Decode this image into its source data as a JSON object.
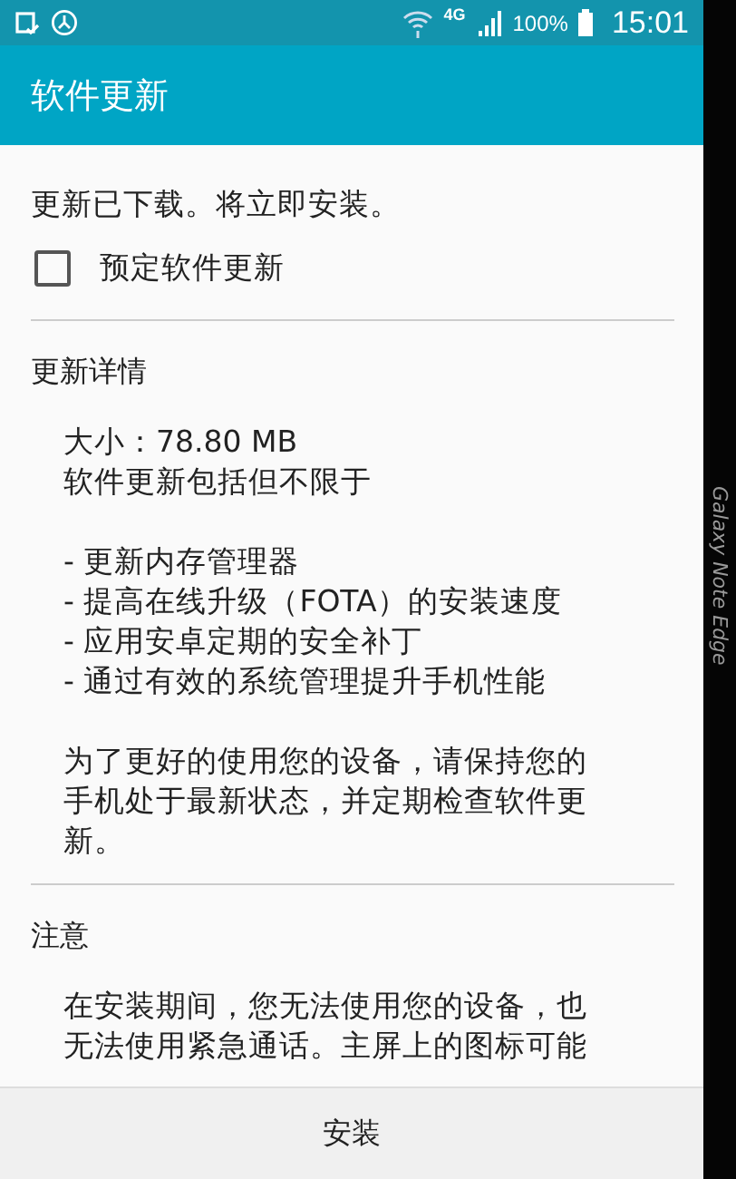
{
  "status_bar": {
    "network": "4G",
    "battery": "100%",
    "time": "15:01"
  },
  "app_bar": {
    "title": "软件更新"
  },
  "message": "更新已下载。将立即安装。",
  "schedule_option": {
    "label": "预定软件更新",
    "checked": false
  },
  "details": {
    "heading": "更新详情",
    "size": "大小：78.80 MB",
    "intro": "软件更新包括但不限于",
    "items": [
      "- 更新内存管理器",
      "- 提高在线升级（FOTA）的安装速度",
      "- 应用安卓定期的安全补丁",
      "- 通过有效的系统管理提升手机性能"
    ],
    "note": "为了更好的使用您的设备，请保持您的手机处于最新状态，并定期检查软件更新。"
  },
  "notice": {
    "heading": "注意",
    "text": "在安装期间，您无法使用您的设备，也无法使用紧急通话。主屏上的图标可能"
  },
  "bottom_bar": {
    "button": "安装"
  },
  "device_edge": {
    "label": "Galaxy Note Edge"
  }
}
